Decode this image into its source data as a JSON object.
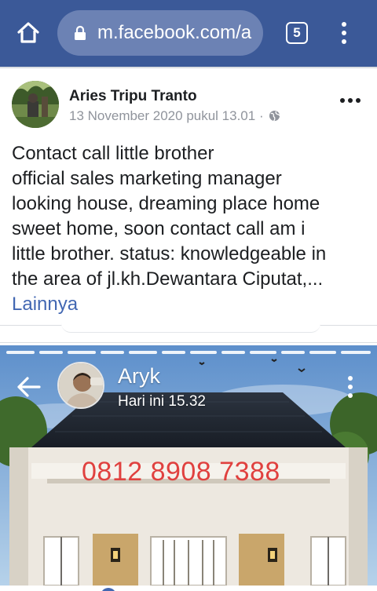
{
  "browser": {
    "url": "m.facebook.com/a",
    "tab_count": "5"
  },
  "post": {
    "author": "Aries Tripu Tranto",
    "timestamp": "13 November 2020 pukul 13.01",
    "privacy_separator": "·",
    "privacy_icon": "globe-icon",
    "text_lines": [
      "Contact call little brother",
      "official sales marketing manager",
      "looking house, dreaming place home",
      "sweet home, soon contact call am i",
      "little brother. status: knowledgeable in",
      "the area of jl.kh.Dewantara Ciputat,..."
    ],
    "more_label": "Lainnya"
  },
  "photo": {
    "status_name": "Aryk",
    "status_time": "Hari ini 15.32",
    "phone_number": "0812 8908 7388"
  },
  "colors": {
    "browser_bar": "#3b5998",
    "url_pill": "#6c82b4",
    "link": "#4267b2",
    "phone_text": "#e0413f"
  }
}
